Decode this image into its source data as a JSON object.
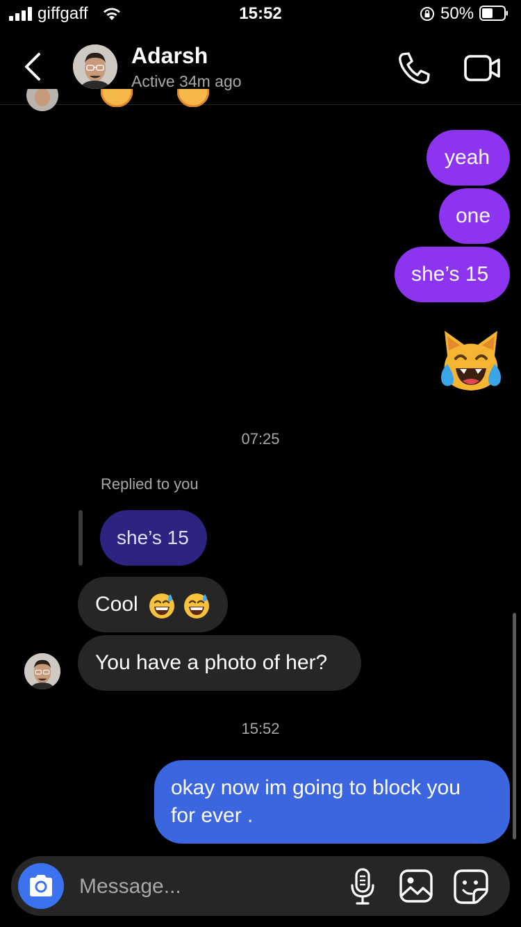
{
  "status_bar": {
    "carrier": "giffgaff",
    "time": "15:52",
    "battery": "50%",
    "battery_level": 0.5
  },
  "header": {
    "name": "Adarsh",
    "status": "Active 34m ago"
  },
  "messages": {
    "sent_1": "yeah",
    "sent_2": "one",
    "sent_3": "she’s 15",
    "timestamp_1": "07:25",
    "replied_label": "Replied to you",
    "quoted": "she’s 15",
    "recv_1": "Cool",
    "recv_2": "You have a photo of her?",
    "timestamp_2": "15:52",
    "sent_4_line1": "okay now im going to block you",
    "sent_4_line2": "for ever ."
  },
  "composer": {
    "placeholder": "Message..."
  },
  "colors": {
    "sent_bubble": "#8d34f0",
    "last_sent_bubble": "#3c66e0",
    "received_bubble": "#262626",
    "quoted_bubble": "#2d2481",
    "camera_button": "#3b72f0"
  },
  "icons": {
    "back": "chevron-left-icon",
    "call": "phone-icon",
    "video": "video-camera-icon",
    "camera": "camera-icon",
    "mic": "microphone-icon",
    "gallery": "image-icon",
    "sticker": "sticker-icon",
    "reaction_sent": "cat-tears-of-joy-emoji",
    "reaction_recv": "grinning-sweat-emoji"
  }
}
